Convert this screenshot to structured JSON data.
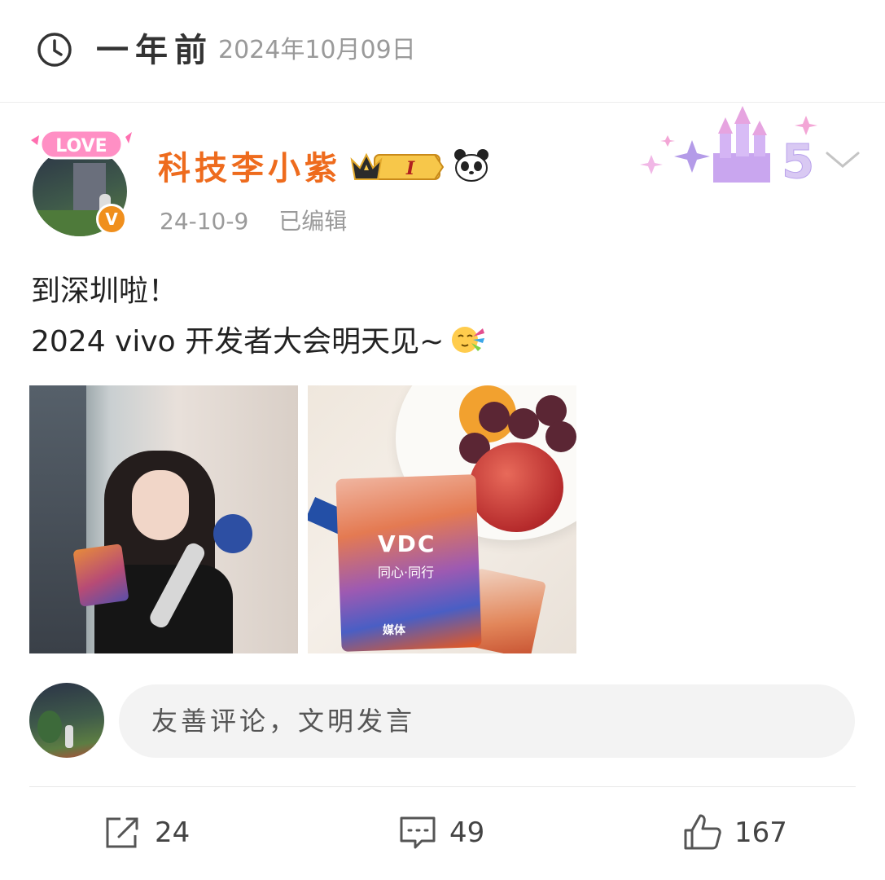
{
  "header": {
    "relative_time": "一年前",
    "date": "2024年10月09日"
  },
  "post": {
    "author": {
      "name": "科技李小紫",
      "level_badge": "I",
      "avatar_badge": "LOVE"
    },
    "meta": {
      "date": "24-10-9",
      "edited": "已编辑"
    },
    "text": {
      "line1": "到深圳啦！",
      "line2": "2024 vivo 开发者大会明天见~"
    },
    "photo2": {
      "logo": "VDC",
      "motto": "同心·同行",
      "badge_label": "媒体"
    }
  },
  "comment_box": {
    "placeholder": "友善评论，文明发言"
  },
  "actions": {
    "shares": "24",
    "comments": "49",
    "likes": "167"
  },
  "colors": {
    "username": "#ee6b1d",
    "verified": "#f08f1d",
    "secondary_text": "#9a9a9a"
  }
}
